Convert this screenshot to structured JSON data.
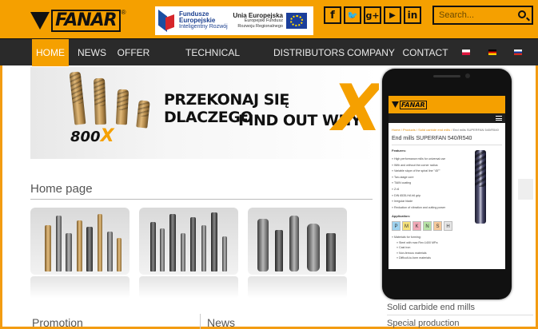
{
  "header": {
    "logo_text": "FANAR",
    "eu_banner": {
      "fe_title": "Fundusze Europejskie",
      "fe_sub": "Inteligentny Rozwój",
      "ue_title": "Unia Europejska",
      "ue_sub": "Europejski Fundusz Rozwoju Regionalnego"
    },
    "social": [
      {
        "name": "facebook-icon",
        "glyph": "f"
      },
      {
        "name": "twitter-icon",
        "glyph": "🐦"
      },
      {
        "name": "google-plus-icon",
        "glyph": "g+"
      },
      {
        "name": "youtube-icon",
        "glyph": "▶"
      },
      {
        "name": "linkedin-icon",
        "glyph": "in"
      }
    ],
    "search_placeholder": "Search..."
  },
  "nav": {
    "items": [
      "HOME",
      "NEWS",
      "OFFER",
      "TECHNICAL CONSULTANCY",
      "DISTRIBUTORS",
      "COMPANY",
      "CONTACT"
    ],
    "active": "HOME",
    "languages": [
      "pl",
      "de",
      "ru"
    ]
  },
  "hero": {
    "badge": "800",
    "badge_x": "X",
    "line1": "PRZEKONAJ SIĘ DLACZEGO",
    "line2": "FIND OUT WHY",
    "big_x": "X"
  },
  "home": {
    "title": "Home page",
    "promotion": "Promotion",
    "news": "News"
  },
  "right": {
    "solid_carbide": "Solid carbide end mills",
    "special": "Special production"
  },
  "phone": {
    "breadcrumb_link": "Home / Products / Solid carbide end mills /",
    "breadcrumb_current": "End mills SUPERFAN 540/R540",
    "title": "End mills SUPERFAN 540/R540",
    "features_label": "Features:",
    "features": [
      "High performance mills for universal use",
      "With and without the corner radius",
      "Variable slope of the spiral line \"45°\"",
      "Two-stage core",
      "TiAlN coating",
      "Z=6",
      "DIN 6535-HA h6 grip",
      "Irregular blade",
      "Reduction of vibration and cutting power"
    ],
    "application_label": "Application:",
    "materials": [
      "P",
      "M",
      "K",
      "N",
      "S",
      "H"
    ],
    "materials_label": "Materials for forming:",
    "materials_list": [
      "Steel with max Rm=1400 MPa",
      "Cast iron",
      "Non-ferrous materials",
      "Difficult-to-form materials"
    ]
  },
  "colors": {
    "brand_orange": "#f5a000",
    "nav_dark": "#2a2a2a"
  }
}
